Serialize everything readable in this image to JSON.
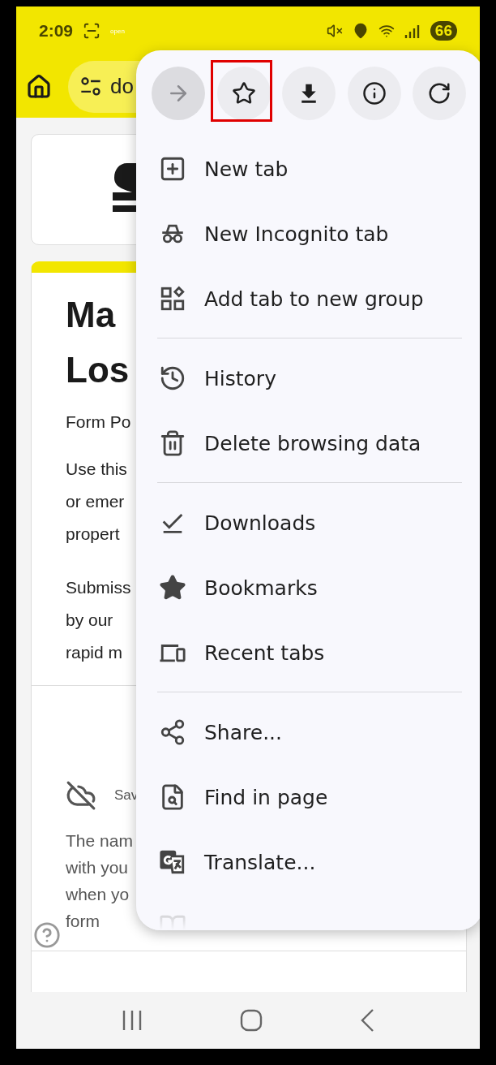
{
  "status_bar": {
    "time": "2:09",
    "notification_label": "open",
    "battery": "66"
  },
  "address_bar": {
    "url": "do"
  },
  "page": {
    "title_lines": [
      "Ma",
      "Los"
    ],
    "subtitle": "Form Po",
    "intro_paragraphs": [
      [
        "Use this",
        "or emer",
        "propert"
      ],
      [
        "Submiss",
        "by our",
        "rapid m"
      ]
    ],
    "save_status": "Sav",
    "note_lines": [
      "The nam",
      "with you",
      "when yo",
      "form"
    ]
  },
  "menu": {
    "toolbar": [
      {
        "kind": "forward",
        "disabled": true,
        "highlighted": false
      },
      {
        "kind": "bookmark",
        "disabled": false,
        "highlighted": true
      },
      {
        "kind": "download",
        "disabled": false,
        "highlighted": false
      },
      {
        "kind": "info",
        "disabled": false,
        "highlighted": false
      },
      {
        "kind": "refresh",
        "disabled": false,
        "highlighted": false
      }
    ],
    "groups": [
      [
        {
          "kind": "new-tab",
          "label": "New tab"
        },
        {
          "kind": "incognito",
          "label": "New Incognito tab"
        },
        {
          "kind": "tab-group",
          "label": "Add tab to new group"
        }
      ],
      [
        {
          "kind": "history",
          "label": "History"
        },
        {
          "kind": "delete",
          "label": "Delete browsing data"
        }
      ],
      [
        {
          "kind": "downloads",
          "label": "Downloads"
        },
        {
          "kind": "bookmarks",
          "label": "Bookmarks"
        },
        {
          "kind": "recent-tabs",
          "label": "Recent tabs"
        }
      ],
      [
        {
          "kind": "share",
          "label": "Share..."
        },
        {
          "kind": "find",
          "label": "Find in page"
        },
        {
          "kind": "translate",
          "label": "Translate..."
        },
        {
          "kind": "reading-mode"
        }
      ]
    ]
  }
}
